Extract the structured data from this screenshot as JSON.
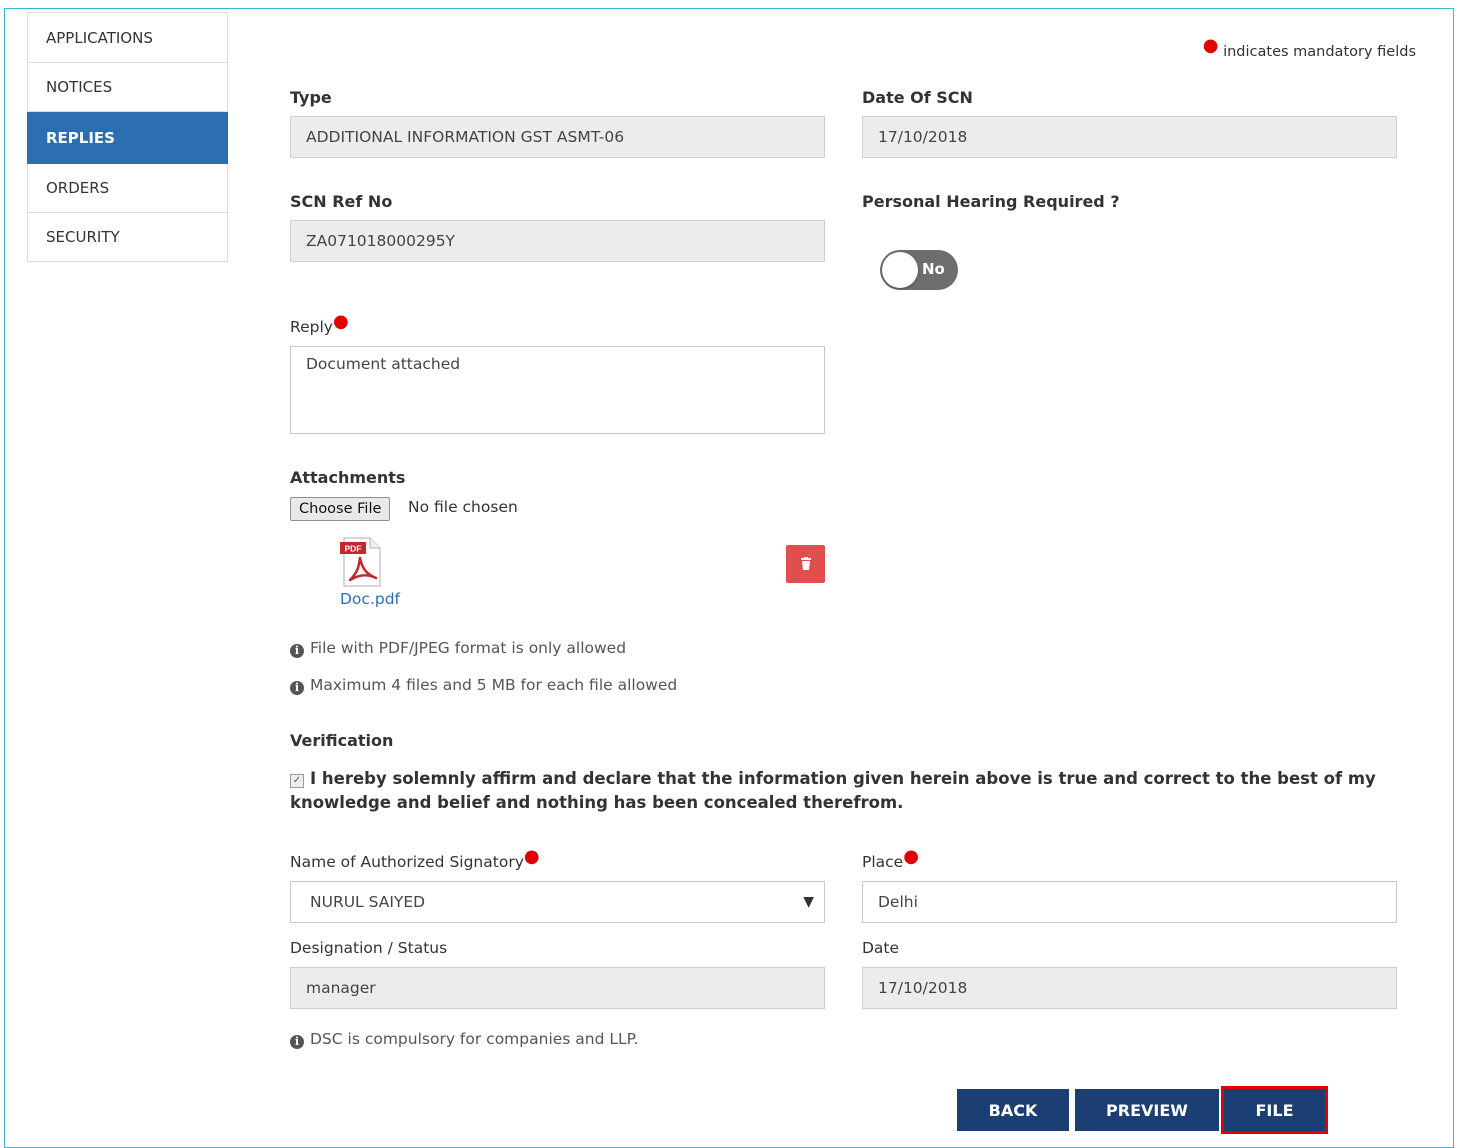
{
  "sidebar": {
    "items": [
      {
        "label": "APPLICATIONS"
      },
      {
        "label": "NOTICES"
      },
      {
        "label": "REPLIES"
      },
      {
        "label": "ORDERS"
      },
      {
        "label": "SECURITY"
      }
    ],
    "active": "REPLIES"
  },
  "mandatory_note": "indicates mandatory fields",
  "form": {
    "type_label": "Type",
    "type_value": "ADDITIONAL INFORMATION GST ASMT-06",
    "date_scn_label": "Date Of SCN",
    "date_scn_value": "17/10/2018",
    "scn_ref_label": "SCN Ref No",
    "scn_ref_value": "ZA071018000295Y",
    "hearing_label": "Personal Hearing Required ?",
    "hearing_toggle": "No",
    "reply_label": "Reply",
    "reply_value": "Document attached",
    "attachments_label": "Attachments",
    "choose_file_label": "Choose File",
    "no_file_text": "No file chosen",
    "attachment_file": "Doc.pdf",
    "pdf_badge": "PDF",
    "info_format": "File with PDF/JPEG format is only allowed",
    "info_max": "Maximum 4 files and 5 MB for each file allowed",
    "verification_label": "Verification",
    "declaration": "I hereby solemnly affirm and declare that the information given herein above is true and correct to the best of my knowledge and belief and nothing has been concealed therefrom.",
    "signatory_label": "Name of Authorized Signatory",
    "signatory_value": "NURUL SAIYED",
    "place_label": "Place",
    "place_value": "Delhi",
    "designation_label": "Designation / Status",
    "designation_value": "manager",
    "date_label": "Date",
    "date_value": "17/10/2018",
    "dsc_note": "DSC is compulsory for companies and LLP."
  },
  "buttons": {
    "back": "BACK",
    "preview": "PREVIEW",
    "file": "FILE"
  },
  "colors": {
    "active_sidebar": "#2c6fb0",
    "button": "#1b3f73",
    "delete_button": "#e04e4e",
    "highlight": "#e00000"
  }
}
